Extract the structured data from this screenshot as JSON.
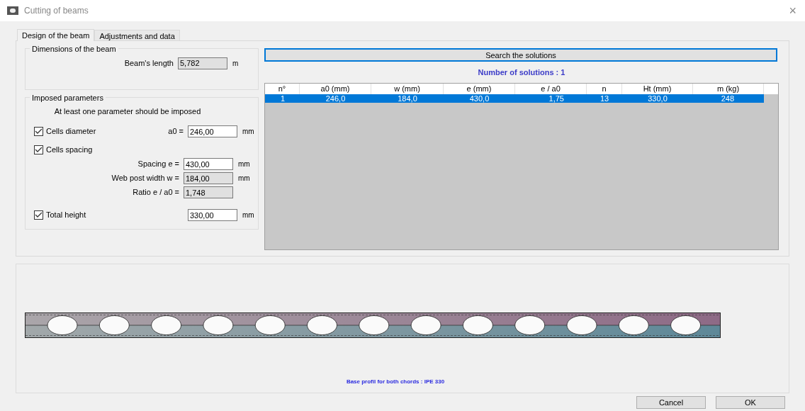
{
  "window": {
    "title": "Cutting of beams",
    "close": "×"
  },
  "tabs": [
    {
      "label": "Design of the beam",
      "selected": true
    },
    {
      "label": "Adjustments and data",
      "selected": false
    }
  ],
  "dimensions": {
    "title": "Dimensions of the beam",
    "fields": [
      {
        "label": "Beam's length",
        "value": "5,782",
        "unit": "m",
        "disabled": true
      }
    ]
  },
  "imposed": {
    "title": "Imposed parameters",
    "note": "At least one parameter should be imposed",
    "rows": [
      {
        "kind": "check",
        "label": "Cells diameter",
        "checked": true,
        "field_label": "a0 =",
        "value": "246,00",
        "unit": "mm",
        "disabled": false
      },
      {
        "kind": "check",
        "label": "Cells spacing",
        "checked": true
      },
      {
        "kind": "field",
        "field_label": "Spacing e =",
        "value": "430,00",
        "unit": "mm",
        "disabled": false
      },
      {
        "kind": "field",
        "field_label": "Web post width w =",
        "value": "184,00",
        "unit": "mm",
        "disabled": true
      },
      {
        "kind": "field",
        "field_label": "Ratio e / a0 =",
        "value": "1,748",
        "disabled": true
      },
      {
        "kind": "check",
        "label": "Total height",
        "checked": true,
        "value": "330,00",
        "unit": "mm",
        "disabled": false
      }
    ]
  },
  "search_button": "Search the solutions",
  "solutions_count": "Number of solutions : 1",
  "table": {
    "columns": [
      "n°",
      "a0 (mm)",
      "w (mm)",
      "e (mm)",
      "e / a0",
      "n",
      "Ht (mm)",
      "m (kg)"
    ],
    "rows": [
      {
        "cells": [
          "1",
          "246,0",
          "184,0",
          "430,0",
          "1,75",
          "13",
          "330,0",
          "248"
        ],
        "selected": true
      }
    ]
  },
  "preview": {
    "kind": "beam",
    "base_profile": "Base profil for both chords : IPE 330"
  },
  "buttons": [
    "Cancel",
    "OK"
  ]
}
